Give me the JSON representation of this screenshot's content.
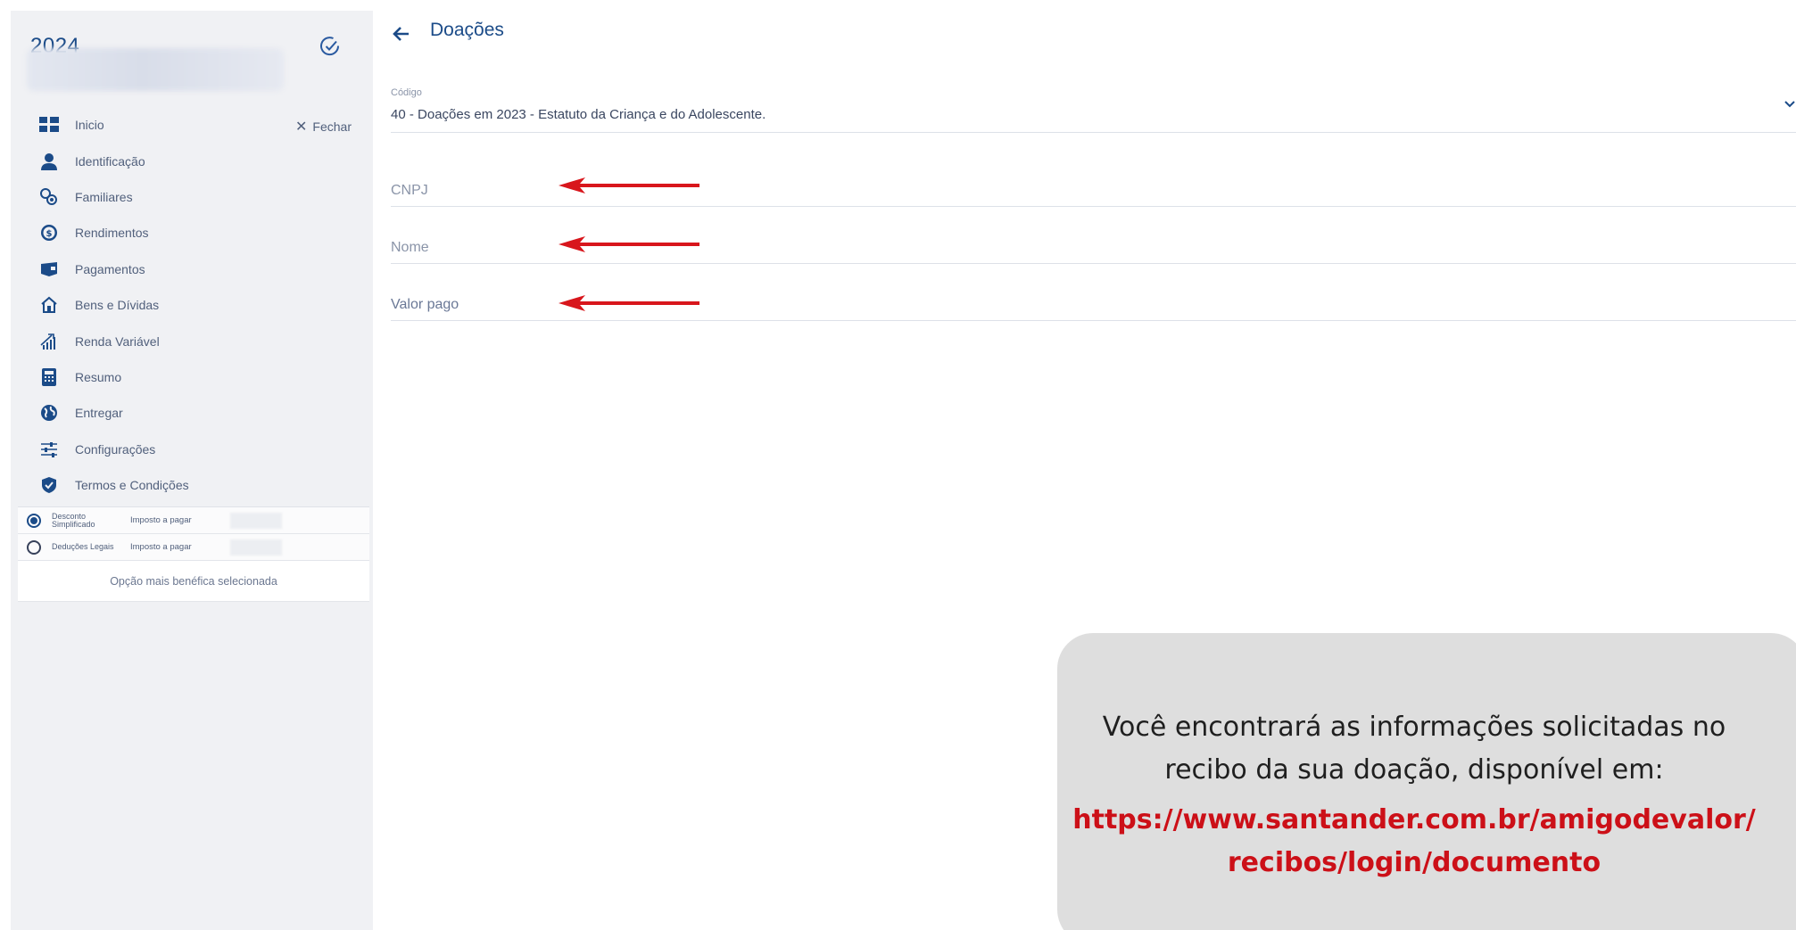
{
  "sidebar": {
    "year": "2024",
    "close_label": "Fechar",
    "items": [
      {
        "label": "Inicio",
        "icon": "grid-icon"
      },
      {
        "label": "Identificação",
        "icon": "person-icon"
      },
      {
        "label": "Familiares",
        "icon": "family-icon"
      },
      {
        "label": "Rendimentos",
        "icon": "dollar-circle-icon"
      },
      {
        "label": "Pagamentos",
        "icon": "wallet-icon"
      },
      {
        "label": "Bens e Dívidas",
        "icon": "house-icon"
      },
      {
        "label": "Renda Variável",
        "icon": "chart-icon"
      },
      {
        "label": "Resumo",
        "icon": "calculator-icon"
      },
      {
        "label": "Entregar",
        "icon": "globe-icon"
      },
      {
        "label": "Configurações",
        "icon": "sliders-icon"
      },
      {
        "label": "Termos e Condições",
        "icon": "shield-check-icon"
      }
    ],
    "regime": {
      "simplificado_label": "Desconto Simplificado",
      "legais_label": "Deduções Legais",
      "tax_label_1": "Imposto a pagar",
      "tax_label_2": "Imposto a pagar",
      "selected": "simplificado",
      "note": "Opção mais benéfica selecionada"
    }
  },
  "main": {
    "title": "Doações",
    "codigo_label": "Código",
    "codigo_value": "40 - Doações em 2023 - Estatuto da Criança e do Adolescente.",
    "fields": {
      "cnpj": "CNPJ",
      "nome": "Nome",
      "valor": "Valor pago"
    }
  },
  "callout": {
    "text": "Você encontrará as informações solicitadas no recibo da sua doação, disponível em:",
    "link_line1": "https://www.santander.com.br/amigodevalor/",
    "link_line2": "recibos/login/documento"
  },
  "colors": {
    "brand_blue": "#1b4b88",
    "arrow_red": "#d8161c",
    "link_red": "#cc1018",
    "sidebar_bg": "#f0f1f4",
    "callout_bg": "#dedede"
  }
}
